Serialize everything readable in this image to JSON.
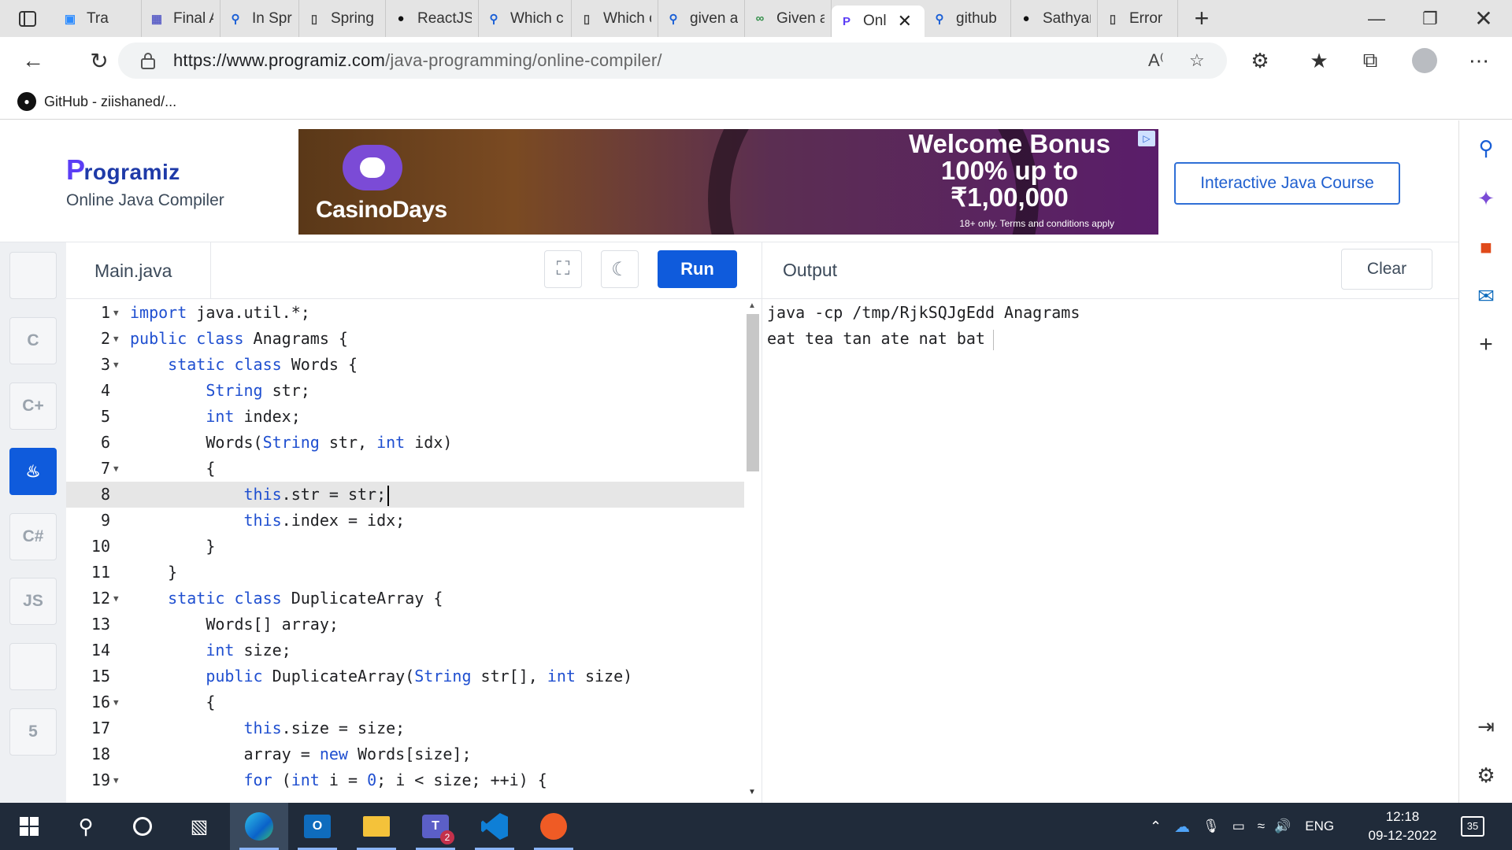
{
  "browser": {
    "tabs": [
      {
        "label": "Tra",
        "icon": "zoom-icon"
      },
      {
        "label": "Final As",
        "icon": "teams-icon"
      },
      {
        "label": "In Sprin",
        "icon": "search-icon"
      },
      {
        "label": "Spring I",
        "icon": "page-icon"
      },
      {
        "label": "ReactJS",
        "icon": "github-icon"
      },
      {
        "label": "Which c",
        "icon": "search-icon"
      },
      {
        "label": "Which c",
        "icon": "page-icon"
      },
      {
        "label": "given ar",
        "icon": "search-icon"
      },
      {
        "label": "Given a",
        "icon": "gfg-icon"
      },
      {
        "label": "Onl",
        "icon": "programiz-icon",
        "active": true
      },
      {
        "label": "github",
        "icon": "search-icon"
      },
      {
        "label": "Sathyar",
        "icon": "github-icon"
      },
      {
        "label": "Error",
        "icon": "page-icon"
      }
    ],
    "url_host": "https://www.programiz.com",
    "url_path": "/java-programming/online-compiler/",
    "favorites": [
      {
        "label": "GitHub - ziishaned/..."
      }
    ]
  },
  "header": {
    "logo_text": "rogramiz",
    "logo_letter": "P",
    "subtitle": "Online Java Compiler",
    "course_button": "Interactive Java Course",
    "ad": {
      "brand": "CasinoDays",
      "headline_1": "Welcome Bonus",
      "headline_2": "100% up to",
      "headline_3": "₹1,00,000",
      "fine_print": "18+ only. Terms and conditions apply"
    }
  },
  "languages": [
    {
      "name": "python",
      "label": ""
    },
    {
      "name": "c",
      "label": "C"
    },
    {
      "name": "cpp",
      "label": "C+"
    },
    {
      "name": "java",
      "label": "♨",
      "active": true
    },
    {
      "name": "csharp",
      "label": "C#"
    },
    {
      "name": "javascript",
      "label": "JS"
    },
    {
      "name": "sql",
      "label": ""
    },
    {
      "name": "html",
      "label": "5"
    }
  ],
  "editor": {
    "file_name": "Main.java",
    "run_label": "Run",
    "current_line": 8,
    "lines": [
      {
        "n": "1",
        "fold": true,
        "code": "<span class=\"k\">import</span> java.util.*;"
      },
      {
        "n": "2",
        "fold": true,
        "code": "<span class=\"k\">public class</span> Anagrams {"
      },
      {
        "n": "3",
        "fold": true,
        "code": "    <span class=\"k\">static class</span> Words {"
      },
      {
        "n": "4",
        "fold": false,
        "code": "        <span class=\"k\">String</span> str;"
      },
      {
        "n": "5",
        "fold": false,
        "code": "        <span class=\"k\">int</span> index;"
      },
      {
        "n": "6",
        "fold": false,
        "code": "        Words(<span class=\"k\">String</span> str, <span class=\"k\">int</span> idx)"
      },
      {
        "n": "7",
        "fold": true,
        "code": "        {"
      },
      {
        "n": "8",
        "fold": false,
        "code": "            <span class=\"k\">this</span>.str = str;<span class=\"caret\"></span>"
      },
      {
        "n": "9",
        "fold": false,
        "code": "            <span class=\"k\">this</span>.index = idx;"
      },
      {
        "n": "10",
        "fold": false,
        "code": "        }"
      },
      {
        "n": "11",
        "fold": false,
        "code": "    }"
      },
      {
        "n": "12",
        "fold": true,
        "code": "    <span class=\"k\">static class</span> DuplicateArray {"
      },
      {
        "n": "13",
        "fold": false,
        "code": "        Words[] array;"
      },
      {
        "n": "14",
        "fold": false,
        "code": "        <span class=\"k\">int</span> size;"
      },
      {
        "n": "15",
        "fold": false,
        "code": "        <span class=\"k\">public</span> DuplicateArray(<span class=\"k\">String</span> str[], <span class=\"k\">int</span> size)"
      },
      {
        "n": "16",
        "fold": true,
        "code": "        {"
      },
      {
        "n": "17",
        "fold": false,
        "code": "            <span class=\"k\">this</span>.size = size;"
      },
      {
        "n": "18",
        "fold": false,
        "code": "            array = <span class=\"k\">new</span> Words[size];"
      },
      {
        "n": "19",
        "fold": true,
        "code": "            <span class=\"k\">for</span> (<span class=\"k\">int</span> i = <span class=\"k\">0</span>; i &lt; size; ++i) {"
      }
    ]
  },
  "output": {
    "title": "Output",
    "clear_label": "Clear",
    "lines": [
      "java -cp /tmp/RjkSQJgEdd Anagrams",
      "eat tea tan ate nat bat"
    ]
  },
  "taskbar": {
    "language": "ENG",
    "time": "12:18",
    "date": "09-12-2022",
    "notifications": "35",
    "teams_badge": "2"
  }
}
